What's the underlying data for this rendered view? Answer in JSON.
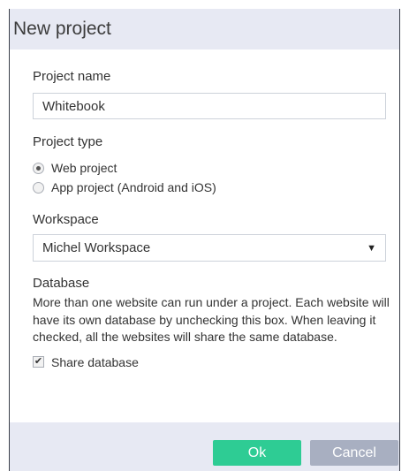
{
  "dialog": {
    "title": "New project"
  },
  "project_name": {
    "label": "Project name",
    "value": "Whitebook"
  },
  "project_type": {
    "label": "Project type",
    "options": [
      {
        "label": "Web project",
        "checked": true
      },
      {
        "label": "App project (Android and iOS)",
        "checked": false
      }
    ]
  },
  "workspace": {
    "label": "Workspace",
    "selected": "Michel Workspace"
  },
  "database": {
    "label": "Database",
    "description": "More than one website can run under a project. Each website will have its own database by unchecking this box. When leaving it checked, all the websites will share the same database.",
    "checkbox_label": "Share database",
    "checked": true
  },
  "buttons": {
    "ok": "Ok",
    "cancel": "Cancel"
  },
  "colors": {
    "titlebar_bg": "#e7e9f3",
    "ok_button": "#2ecc94",
    "cancel_button": "#a8afc1"
  }
}
